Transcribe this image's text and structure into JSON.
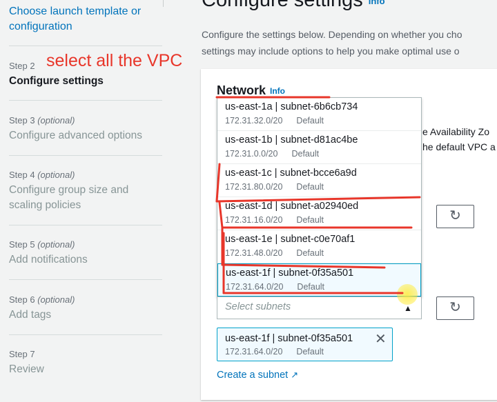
{
  "sidebar": {
    "top_link": "Choose launch template or configuration",
    "steps": [
      {
        "label": "Step 2",
        "optional": "",
        "title": "Configure settings"
      },
      {
        "label": "Step 3",
        "optional": "(optional)",
        "title": "Configure advanced options"
      },
      {
        "label": "Step 4",
        "optional": "(optional)",
        "title": "Configure group size and scaling policies"
      },
      {
        "label": "Step 5",
        "optional": "(optional)",
        "title": "Add notifications"
      },
      {
        "label": "Step 6",
        "optional": "(optional)",
        "title": "Add tags"
      },
      {
        "label": "Step 7",
        "optional": "",
        "title": "Review"
      }
    ]
  },
  "annotation": "select all the VPC",
  "header": {
    "title": "Configure settings",
    "info": "Info",
    "desc_line1": "Configure the settings below. Depending on whether you cho",
    "desc_line2": "settings may include options to help you make optimal use o"
  },
  "network": {
    "title": "Network",
    "info": "Info",
    "bg_line1": "e Availability Zo",
    "bg_line2": "he default VPC a",
    "subnets_placeholder": "Select subnets",
    "options": [
      {
        "name": "us-east-1a | subnet-6b6cb734",
        "cidr": "172.31.32.0/20",
        "tag": "Default"
      },
      {
        "name": "us-east-1b | subnet-d81ac4be",
        "cidr": "172.31.0.0/20",
        "tag": "Default"
      },
      {
        "name": "us-east-1c | subnet-bcce6a9d",
        "cidr": "172.31.80.0/20",
        "tag": "Default"
      },
      {
        "name": "us-east-1d | subnet-a02940ed",
        "cidr": "172.31.16.0/20",
        "tag": "Default"
      },
      {
        "name": "us-east-1e | subnet-c0e70af1",
        "cidr": "172.31.48.0/20",
        "tag": "Default"
      },
      {
        "name": "us-east-1f | subnet-0f35a501",
        "cidr": "172.31.64.0/20",
        "tag": "Default"
      }
    ],
    "selected_token": {
      "name": "us-east-1f | subnet-0f35a501",
      "cidr": "172.31.64.0/20",
      "tag": "Default"
    },
    "create_subnet": "Create a subnet"
  },
  "colors": {
    "link": "#0073bb",
    "annotation": "#e8362a",
    "selected_border": "#00a1c9"
  },
  "icons": [
    "refresh-icon",
    "close-icon",
    "external-link-icon",
    "caret-up-icon"
  ]
}
